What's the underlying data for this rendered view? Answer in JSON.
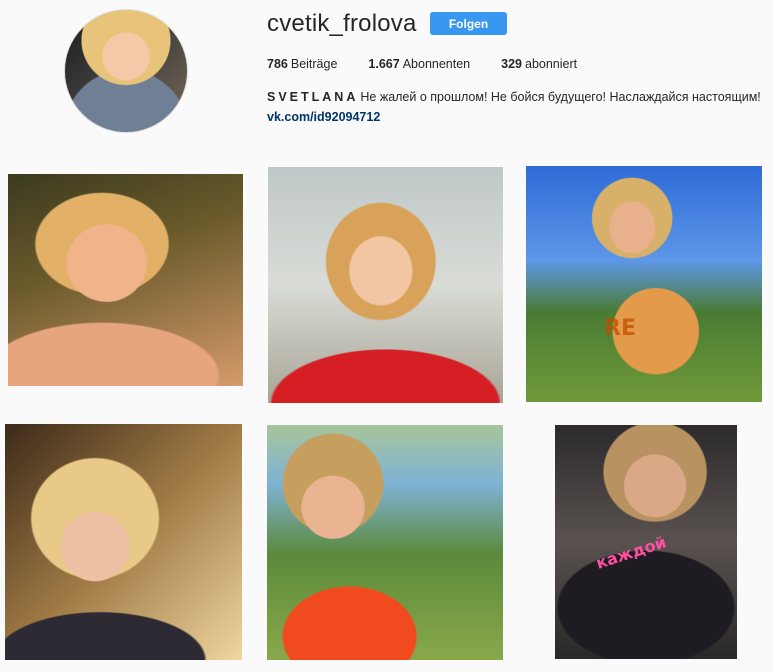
{
  "profile": {
    "username": "cvetik_frolova",
    "follow_label": "Folgen",
    "stats": [
      {
        "count": "786",
        "label": "Beiträge"
      },
      {
        "count": "1.667",
        "label": "Abonnenten"
      },
      {
        "count": "329",
        "label": "abonniert"
      }
    ],
    "bio_name": "SVETLANA",
    "bio_text": "Не жалей о прошлом! Не бойся будущего! Наслаждайся настоящим!",
    "link": "vk.com/id92094712"
  },
  "posts": [
    {
      "text": ""
    },
    {
      "text": ""
    },
    {
      "text": "RE"
    },
    {
      "text": ""
    },
    {
      "text": ""
    },
    {
      "text": "каждой"
    }
  ],
  "colors": {
    "accent": "#3897f0",
    "link": "#003569",
    "background": "#fafafa"
  }
}
